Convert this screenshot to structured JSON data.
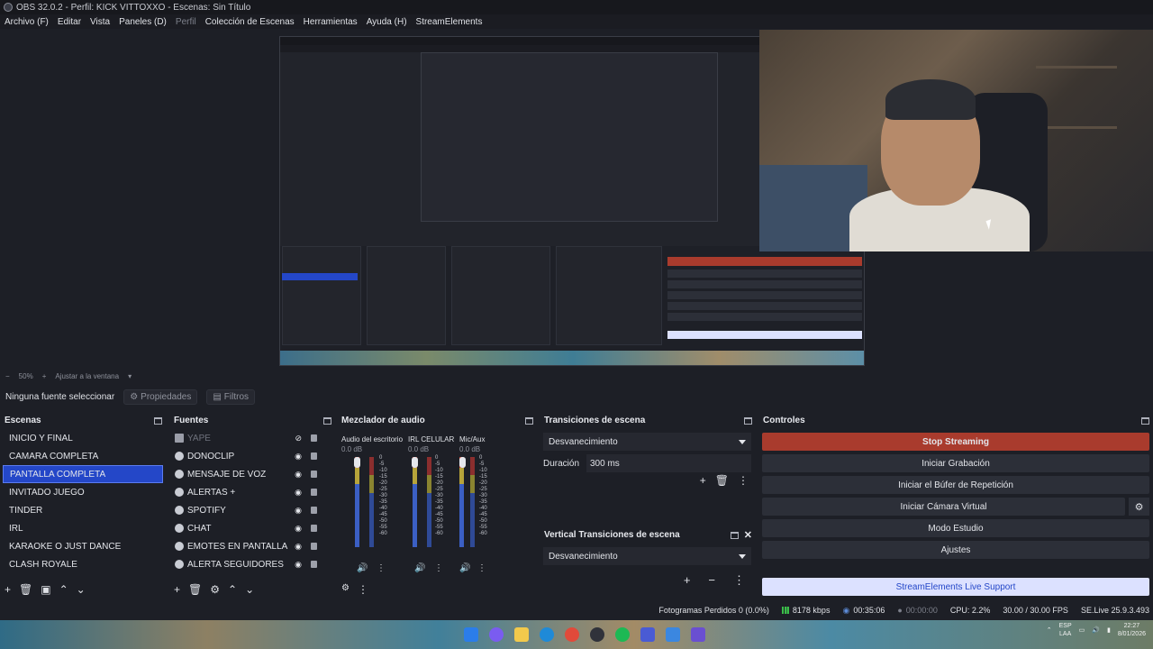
{
  "window": {
    "title": "OBS 32.0.2 - Perfil: KICK VITTOXXO - Escenas: Sin Título"
  },
  "menu": [
    "Archivo (F)",
    "Editar",
    "Vista",
    "Paneles (D)",
    "Perfil",
    "Colección de Escenas",
    "Herramientas",
    "Ayuda (H)",
    "StreamElements"
  ],
  "preview": {
    "zoom": "50%",
    "zoom_plus": "+",
    "fit_label": "Ajustar a la ventana"
  },
  "properties_bar": {
    "no_source": "Ninguna fuente seleccionar",
    "properties": "Propiedades",
    "filters": "Filtros"
  },
  "scenes": {
    "title": "Escenas",
    "items": [
      "INICIO Y FINAL",
      "CAMARA COMPLETA",
      "PANTALLA COMPLETA",
      "INVITADO JUEGO",
      "TINDER",
      "IRL",
      "KARAOKE O JUST DANCE",
      "CLASH ROYALE"
    ],
    "selected": "PANTALLA COMPLETA"
  },
  "sources": {
    "title": "Fuentes",
    "items": [
      "YAPE",
      "DONOCLIP",
      "MENSAJE DE VOZ",
      "ALERTAS +",
      "SPOTIFY",
      "CHAT",
      "EMOTES EN PANTALLA",
      "ALERTA SEGUIDORES"
    ]
  },
  "mixer": {
    "title": "Mezclador de audio",
    "channels": [
      {
        "name": "Audio del escritorio",
        "db": "0.0 dB"
      },
      {
        "name": "IRL CELULAR",
        "db": "0.0 dB"
      },
      {
        "name": "Mic/Aux",
        "db": "0.0 dB"
      }
    ],
    "scale": [
      "0",
      "-5",
      "-10",
      "-15",
      "-20",
      "-25",
      "-30",
      "-35",
      "-40",
      "-45",
      "-50",
      "-55",
      "-60"
    ]
  },
  "transitions": {
    "title": "Transiciones de escena",
    "selected": "Desvanecimiento",
    "duration_label": "Duración",
    "duration_value": "300 ms",
    "vertical_title": "Vertical Transiciones de escena",
    "vertical_selected": "Desvanecimiento"
  },
  "controls": {
    "title": "Controles",
    "stop_streaming": "Stop Streaming",
    "start_recording": "Iniciar Grabación",
    "replay_buffer": "Iniciar el Búfer de Repetición",
    "virtual_camera": "Iniciar Cámara Virtual",
    "studio_mode": "Modo Estudio",
    "settings": "Ajustes",
    "live_support": "StreamElements Live Support"
  },
  "status": {
    "dropped_frames": "Fotogramas Perdidos 0 (0.0%)",
    "bitrate": "8178 kbps",
    "stream_time": "00:35:06",
    "rec_time": "00:00:00",
    "cpu": "CPU: 2.2%",
    "fps": "30.00 / 30.00 FPS",
    "se_version": "SE.Live 25.9.3.493"
  },
  "taskbar": {
    "lang_top": "ESP",
    "lang_bottom": "LAA",
    "time": "22:27",
    "date": "8/01/2026"
  },
  "colors": {
    "accent_blue": "#2447c8",
    "stop_red": "#a93b2d",
    "panel_bg": "#1d1f26"
  }
}
